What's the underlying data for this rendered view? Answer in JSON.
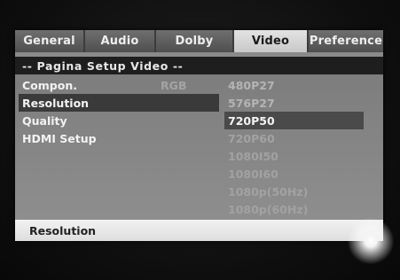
{
  "tabs": [
    {
      "label": "General",
      "active": false
    },
    {
      "label": "Audio",
      "active": false
    },
    {
      "label": "Dolby",
      "active": false
    },
    {
      "label": "Video",
      "active": true
    },
    {
      "label": "Preference",
      "active": false
    }
  ],
  "header": {
    "title": "-- Pagina Setup Video --"
  },
  "left_menu": {
    "items": [
      {
        "label": "Compon.",
        "value": "RGB"
      },
      {
        "label": "Resolution",
        "selected": true
      },
      {
        "label": "Quality"
      },
      {
        "label": "HDMI Setup"
      }
    ]
  },
  "resolution_options": {
    "items": [
      {
        "label": "480P27"
      },
      {
        "label": "576P27"
      },
      {
        "label": "720P50",
        "selected": true
      },
      {
        "label": "720P60"
      },
      {
        "label": "1080I50"
      },
      {
        "label": "1080I60"
      },
      {
        "label": "1080p(50Hz)"
      },
      {
        "label": "1080p(60Hz)"
      }
    ]
  },
  "footer": {
    "text": "Resolution"
  },
  "colors": {
    "panel": "#8a8a8a",
    "header": "#1e1e1e",
    "selection": "#3a3a3a",
    "footer": "#e8e8e8"
  }
}
